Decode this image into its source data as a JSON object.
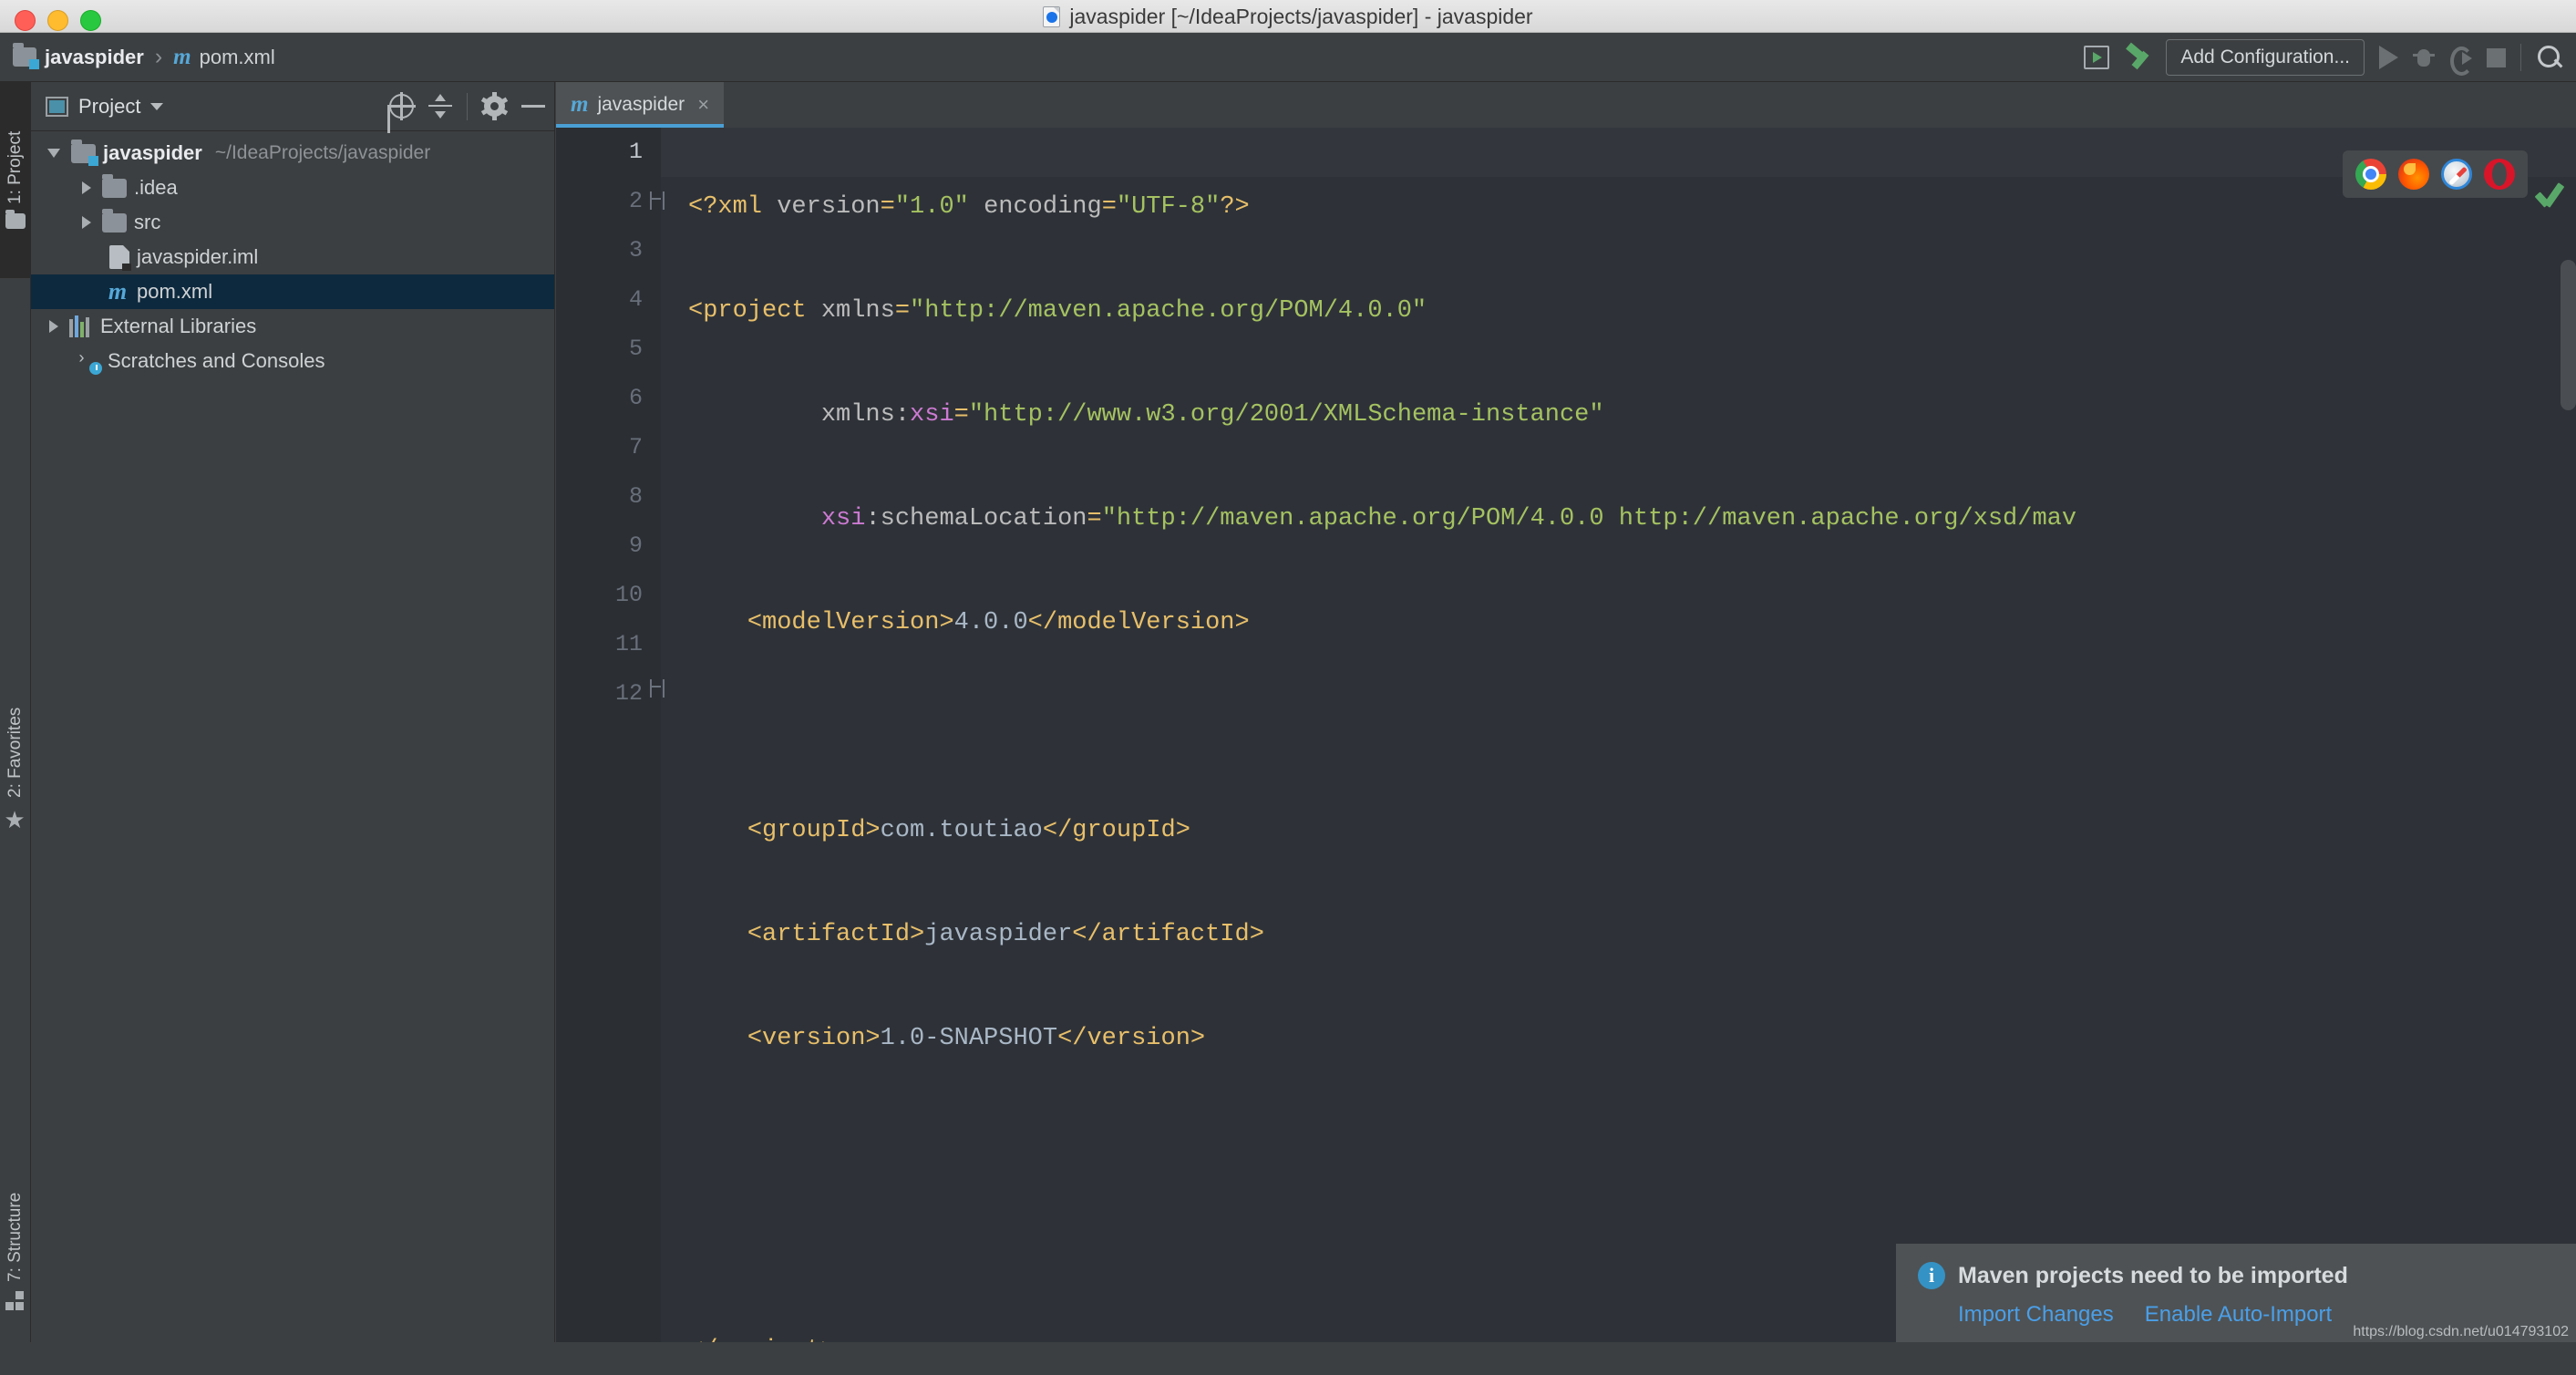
{
  "window": {
    "title": "javaspider [~/IdeaProjects/javaspider] - javaspider",
    "traffic_lights": [
      "close",
      "minimize",
      "zoom"
    ],
    "accent_color": "#4a9fd4"
  },
  "breadcrumb": {
    "project": "javaspider",
    "separator": "›",
    "file": "pom.xml",
    "file_icon": "m"
  },
  "toolbar": {
    "run_box_icon": "run-in-box-icon",
    "build_icon": "hammer-icon",
    "add_configuration_label": "Add Configuration...",
    "run_icon": "play-icon",
    "debug_icon": "bug-icon",
    "coverage_icon": "coverage-icon",
    "stop_icon": "stop-icon",
    "search_icon": "search-icon"
  },
  "rail": {
    "items": [
      {
        "label": "1: Project",
        "icon": "folder-icon",
        "active": true
      },
      {
        "label": "2: Favorites",
        "icon": "star-icon",
        "active": false
      },
      {
        "label": "7: Structure",
        "icon": "structure-icon",
        "active": false
      }
    ]
  },
  "project_panel": {
    "title": "Project",
    "title_dropdown": "▼",
    "actions": [
      "locate-icon",
      "collapse-all-icon",
      "settings-icon",
      "hide-icon"
    ],
    "tree": [
      {
        "indent": 0,
        "arrow": "down",
        "icon": "module-folder-icon",
        "label": "javaspider",
        "bold": true,
        "path": "~/IdeaProjects/javaspider",
        "selected": false
      },
      {
        "indent": 1,
        "arrow": "right",
        "icon": "folder-icon",
        "label": ".idea",
        "bold": false,
        "path": "",
        "selected": false
      },
      {
        "indent": 1,
        "arrow": "right",
        "icon": "folder-icon",
        "label": "src",
        "bold": false,
        "path": "",
        "selected": false
      },
      {
        "indent": 1,
        "arrow": "none",
        "icon": "iml-file-icon",
        "label": "javaspider.iml",
        "bold": false,
        "path": "",
        "selected": false
      },
      {
        "indent": 1,
        "arrow": "none",
        "icon": "maven-file-icon",
        "label": "pom.xml",
        "bold": false,
        "path": "",
        "selected": true
      },
      {
        "indent": 0,
        "arrow": "right",
        "icon": "libraries-icon",
        "label": "External Libraries",
        "bold": false,
        "path": "",
        "selected": false
      },
      {
        "indent": 0,
        "arrow": "none",
        "icon": "scratches-icon",
        "label": "Scratches and Consoles",
        "bold": false,
        "path": "",
        "selected": false
      }
    ]
  },
  "editor": {
    "tabs": [
      {
        "label": "javaspider",
        "icon": "maven-file-icon",
        "close": "×",
        "active": true
      }
    ],
    "browsers": [
      "chrome-icon",
      "firefox-icon",
      "safari-icon",
      "opera-icon"
    ],
    "inspection_status": "ok-check-icon",
    "current_line": 1,
    "lines": [
      {
        "n": 1,
        "fold": false
      },
      {
        "n": 2,
        "fold": true
      },
      {
        "n": 3,
        "fold": false
      },
      {
        "n": 4,
        "fold": false
      },
      {
        "n": 5,
        "fold": false
      },
      {
        "n": 6,
        "fold": false
      },
      {
        "n": 7,
        "fold": false
      },
      {
        "n": 8,
        "fold": false
      },
      {
        "n": 9,
        "fold": false
      },
      {
        "n": 10,
        "fold": false
      },
      {
        "n": 11,
        "fold": false
      },
      {
        "n": 12,
        "fold": true
      }
    ],
    "code_text": {
      "l1": "<?xml version=\"1.0\" encoding=\"UTF-8\"?>",
      "l2": "<project xmlns=\"http://maven.apache.org/POM/4.0.0\"",
      "l3": "         xmlns:xsi=\"http://www.w3.org/2001/XMLSchema-instance\"",
      "l4": "         xsi:schemaLocation=\"http://maven.apache.org/POM/4.0.0 http://maven.apache.org/xsd/mav",
      "l5": "    <modelVersion>4.0.0</modelVersion>",
      "l6": "",
      "l7": "    <groupId>com.toutiao</groupId>",
      "l8": "    <artifactId>javaspider</artifactId>",
      "l9": "    <version>1.0-SNAPSHOT</version>",
      "l10": "",
      "l11": "",
      "l12": "</project>"
    },
    "syntax_colors": {
      "tag": "#e8bf6a",
      "attribute": "#bbbbbb",
      "value": "#a5c261",
      "namespace": "#cc7ad2",
      "text": "#a9b7c6",
      "background": "#2e3238",
      "gutter": "#2b2e33"
    }
  },
  "notification": {
    "icon": "info-icon",
    "icon_glyph": "i",
    "title": "Maven projects need to be imported",
    "links": [
      "Import Changes",
      "Enable Auto-Import"
    ],
    "watermark": "https://blog.csdn.net/u014793102"
  }
}
